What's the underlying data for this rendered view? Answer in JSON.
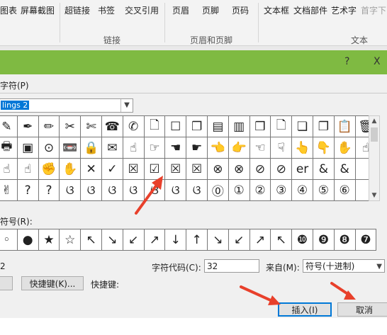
{
  "ribbon": {
    "items": [
      {
        "id": "table",
        "label": "图表",
        "dim": false
      },
      {
        "id": "screenshot",
        "label": "屏幕截图",
        "dim": false
      },
      {
        "id": "hyperlink",
        "label": "超链接",
        "dim": false
      },
      {
        "id": "bookmark",
        "label": "书签",
        "dim": false
      },
      {
        "id": "crossref",
        "label": "交叉引用",
        "dim": false
      },
      {
        "id": "header",
        "label": "页眉",
        "dim": false
      },
      {
        "id": "footer",
        "label": "页脚",
        "dim": false
      },
      {
        "id": "pagenum",
        "label": "页码",
        "dim": false
      },
      {
        "id": "textbox",
        "label": "文本框",
        "dim": false
      },
      {
        "id": "quickparts",
        "label": "文档部件",
        "dim": false
      },
      {
        "id": "wordart",
        "label": "艺术字",
        "dim": false
      },
      {
        "id": "dropcap",
        "label": "首字下",
        "dim": true
      }
    ],
    "groups": {
      "links": "链接",
      "header_footer": "页眉和页脚",
      "text": "文本"
    }
  },
  "dialog": {
    "help_button": "?",
    "close_button": "X",
    "tab_label": "字符(P)",
    "font_value": "lings 2",
    "recent_label": "符号(R):",
    "char_name": "2",
    "char_code_label": "字符代码(C):",
    "char_code_value": "32",
    "from_label": "来自(M):",
    "from_value": "符号(十进制)",
    "autocorrect_button": "",
    "shortcut_key_button": "快捷键(K)...",
    "shortcut_label": "快捷键:",
    "insert_button": "插入(I)",
    "cancel_button": "取消"
  },
  "symbol_grid": [
    [
      "✎",
      "✒",
      "✏",
      "✂",
      "✄",
      "☎",
      "✆",
      "🗋",
      "☐",
      "❐",
      "▤",
      "▥",
      "❒",
      "🗋",
      "❏",
      "❐",
      "📋",
      "🗑"
    ],
    [
      "🖶",
      "▣",
      "⊙",
      "📼",
      "🔒",
      "✉",
      "☝",
      "☞",
      "☚",
      "☛",
      "👈",
      "👉",
      "☜",
      "☟",
      "👆",
      "👇",
      "✋",
      "☝"
    ],
    [
      "☝",
      "☝",
      "✊",
      "✋",
      "✕",
      "✓",
      "☒",
      "☑",
      "☒",
      "☒",
      "⊗",
      "⊗",
      "⊘",
      "⊘",
      "er",
      "&",
      "&",
      ""
    ],
    [
      "✌",
      "?",
      "?",
      "ଓ",
      "ଓ",
      "ଓ",
      "ଓ",
      "ଓ",
      "ଓ",
      "ଓ",
      "⓪",
      "①",
      "②",
      "③",
      "④",
      "⑤",
      "⑥",
      ""
    ]
  ],
  "recent_symbols": [
    "◦",
    "●",
    "★",
    "☆",
    "↖",
    "↘",
    "↙",
    "↗",
    "↓",
    "↑",
    "↘",
    "↙",
    "↗",
    "↖",
    "❿",
    "❾",
    "❽",
    "❼"
  ]
}
